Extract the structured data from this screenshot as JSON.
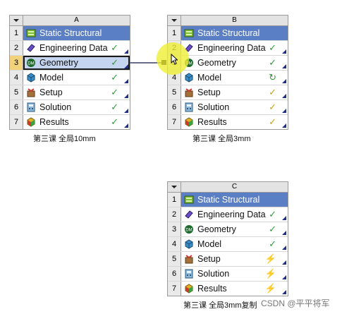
{
  "systems": [
    {
      "letter": "A",
      "caption": "第三课 全局10mm",
      "rows": [
        {
          "num": "1",
          "label": "Static Structural",
          "icon": "static-structural-icon",
          "status": ""
        },
        {
          "num": "2",
          "label": "Engineering Data",
          "icon": "engineering-data-icon",
          "status": "✓"
        },
        {
          "num": "3",
          "label": "Geometry",
          "icon": "geometry-icon",
          "status": "✓"
        },
        {
          "num": "4",
          "label": "Model",
          "icon": "model-icon",
          "status": "✓"
        },
        {
          "num": "5",
          "label": "Setup",
          "icon": "setup-icon",
          "status": "✓"
        },
        {
          "num": "6",
          "label": "Solution",
          "icon": "solution-icon",
          "status": "✓"
        },
        {
          "num": "7",
          "label": "Results",
          "icon": "results-icon",
          "status": "✓"
        }
      ]
    },
    {
      "letter": "B",
      "caption": "第三课 全局3mm",
      "rows": [
        {
          "num": "1",
          "label": "Static Structural",
          "icon": "static-structural-icon",
          "status": ""
        },
        {
          "num": "2",
          "label": "Engineering Data",
          "icon": "engineering-data-icon",
          "status": "✓"
        },
        {
          "num": "3",
          "label": "Geometry",
          "icon": "geometry-icon",
          "status": "✓"
        },
        {
          "num": "4",
          "label": "Model",
          "icon": "model-icon",
          "status": "↻"
        },
        {
          "num": "5",
          "label": "Setup",
          "icon": "setup-icon",
          "status": "✓"
        },
        {
          "num": "6",
          "label": "Solution",
          "icon": "solution-icon",
          "status": "✓"
        },
        {
          "num": "7",
          "label": "Results",
          "icon": "results-icon",
          "status": "✓"
        }
      ]
    },
    {
      "letter": "C",
      "caption": "第三课 全局3mm复制",
      "rows": [
        {
          "num": "1",
          "label": "Static Structural",
          "icon": "static-structural-icon",
          "status": ""
        },
        {
          "num": "2",
          "label": "Engineering Data",
          "icon": "engineering-data-icon",
          "status": "✓"
        },
        {
          "num": "3",
          "label": "Geometry",
          "icon": "geometry-icon",
          "status": "✓"
        },
        {
          "num": "4",
          "label": "Model",
          "icon": "model-icon",
          "status": "✓"
        },
        {
          "num": "5",
          "label": "Setup",
          "icon": "setup-icon",
          "status": "⚡"
        },
        {
          "num": "6",
          "label": "Solution",
          "icon": "solution-icon",
          "status": "⚡"
        },
        {
          "num": "7",
          "label": "Results",
          "icon": "results-icon",
          "status": "⚡"
        }
      ]
    }
  ],
  "watermark": "CSDN @平平将军",
  "colors": {
    "title_bg": "#5b7fc4",
    "check": "#2e9b3a",
    "pending": "#c9a21a",
    "highlight": "#c5d4ef"
  }
}
